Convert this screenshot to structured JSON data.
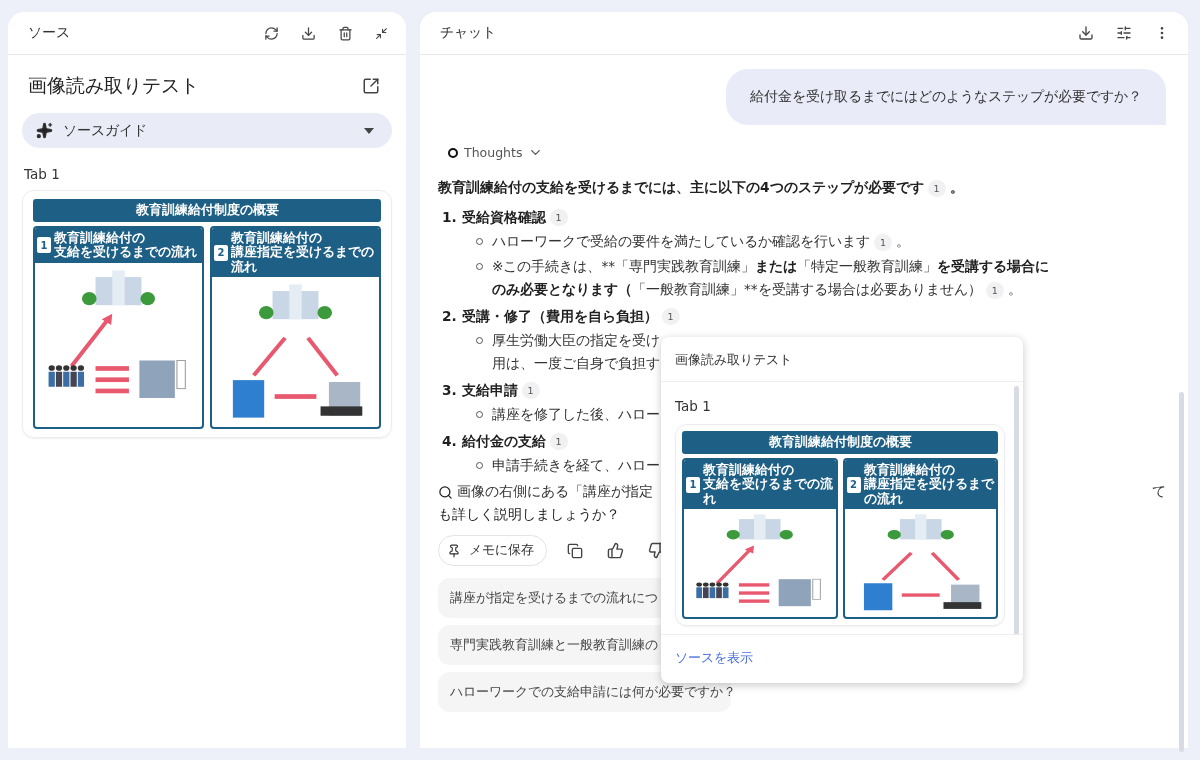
{
  "source_panel": {
    "title": "ソース",
    "source_title": "画像読み取りテスト",
    "guide": {
      "label": "ソースガイド",
      "expanded": false
    },
    "tab_label": "Tab 1",
    "image": {
      "title": "教育訓練給付制度の概要",
      "sections": [
        {
          "number": "1",
          "heading_lines": [
            "教育訓練給付の",
            "支給を受けるまでの流れ"
          ],
          "kind": "payment"
        },
        {
          "number": "2",
          "heading_lines": [
            "教育訓練給付の",
            "講座指定を受けるまでの流れ"
          ],
          "kind": "designation"
        }
      ]
    }
  },
  "chat_panel": {
    "title": "チャット",
    "user_message": "給付金を受け取るまでにはどのようなステップが必要ですか？",
    "thoughts": {
      "label": "Thoughts",
      "expanded": false
    },
    "intro": {
      "text": "教育訓練給付の支給を受けるまでには、主に以下の4つのステップが必要です",
      "citation": "1",
      "tail": "。"
    },
    "steps": [
      {
        "number": "1.",
        "title": "受給資格確認",
        "citation": "1",
        "bullets": [
          {
            "segments": [
              {
                "text": "ハローワークで受給の要件を満たしているか確認を行います",
                "bold": false
              }
            ],
            "citation": "1",
            "tail": "。"
          },
          {
            "segments": [
              {
                "text": "※この手続きは、**「専門実践教育訓練」",
                "bold": false
              },
              {
                "text": "または",
                "bold": true
              },
              {
                "text": "「特定一般教育訓練」",
                "bold": false
              },
              {
                "text": "を受講する場合にのみ必要となります（",
                "bold": true
              },
              {
                "text": "「一般教育訓練」**を受講する場合は必要ありません）",
                "bold": false
              }
            ],
            "citation": "1",
            "tail": "。"
          }
        ]
      },
      {
        "number": "2.",
        "title": "受講・修了（費用を自ら負担）",
        "citation": "1",
        "bullets": [
          {
            "segments": [
              {
                "text": "厚生労働大臣の指定を受け",
                "bold": false
              }
            ]
          },
          {
            "continuation": true,
            "segments": [
              {
                "text": "用は、一度ご自身で負担す",
                "bold": false
              }
            ]
          }
        ]
      },
      {
        "number": "3.",
        "title": "支給申請",
        "citation": "1",
        "bullets": [
          {
            "segments": [
              {
                "text": "講座を修了した後、ハロー",
                "bold": false
              }
            ]
          }
        ]
      },
      {
        "number": "4.",
        "title": "給付金の支給",
        "citation": "1",
        "bullets": [
          {
            "segments": [
              {
                "text": "申請手続きを経て、ハロー",
                "bold": false
              }
            ]
          }
        ]
      }
    ],
    "followup": {
      "line1": "画像の右側にある「講座が指定",
      "line1_end": "て",
      "line2": "も詳しく説明しましょうか？"
    },
    "save_note": "メモに保存",
    "suggestions": [
      "講座が指定を受けるまでの流れにつ",
      "専門実践教育訓練と一般教育訓練の",
      "ハローワークでの支給申請には何が必要ですか？"
    ]
  },
  "popover": {
    "title": "画像読み取りテスト",
    "tab_label": "Tab 1",
    "link": "ソースを表示",
    "image": {
      "title": "教育訓練給付制度の概要",
      "sections": [
        {
          "number": "1",
          "heading_lines": [
            "教育訓練給付の",
            "支給を受けるまでの流れ"
          ],
          "kind": "payment"
        },
        {
          "number": "2",
          "heading_lines": [
            "教育訓練給付の",
            "講座指定を受けるまでの流れ"
          ],
          "kind": "designation"
        }
      ]
    }
  }
}
